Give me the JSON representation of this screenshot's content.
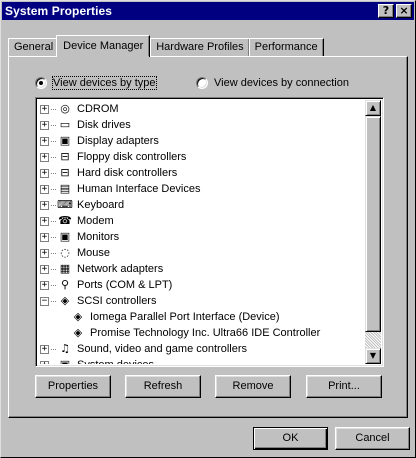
{
  "window": {
    "title": "System Properties",
    "help_label": "?",
    "close_label": "×"
  },
  "tabs": [
    {
      "label": "General"
    },
    {
      "label": "Device Manager"
    },
    {
      "label": "Hardware Profiles"
    },
    {
      "label": "Performance"
    }
  ],
  "active_tab": "Device Manager",
  "view_options": {
    "by_type": "View devices by type",
    "by_connection": "View devices by connection",
    "selected": "by_type"
  },
  "devices": [
    {
      "label": "CDROM",
      "icon": "cdrom-icon",
      "glyph": "◎",
      "expander": "+"
    },
    {
      "label": "Disk drives",
      "icon": "disk-drive-icon",
      "glyph": "▭",
      "expander": "+"
    },
    {
      "label": "Display adapters",
      "icon": "monitor-icon",
      "glyph": "▣",
      "expander": "+"
    },
    {
      "label": "Floppy disk controllers",
      "icon": "floppy-controller-icon",
      "glyph": "⊟",
      "expander": "+"
    },
    {
      "label": "Hard disk controllers",
      "icon": "hard-disk-controller-icon",
      "glyph": "⊟",
      "expander": "+"
    },
    {
      "label": "Human Interface Devices",
      "icon": "hid-icon",
      "glyph": "▤",
      "expander": "+"
    },
    {
      "label": "Keyboard",
      "icon": "keyboard-icon",
      "glyph": "⌨",
      "expander": "+"
    },
    {
      "label": "Modem",
      "icon": "modem-icon",
      "glyph": "☎",
      "expander": "+"
    },
    {
      "label": "Monitors",
      "icon": "monitor-icon",
      "glyph": "▣",
      "expander": "+"
    },
    {
      "label": "Mouse",
      "icon": "mouse-icon",
      "glyph": "◌",
      "expander": "+"
    },
    {
      "label": "Network adapters",
      "icon": "network-adapter-icon",
      "glyph": "▦",
      "expander": "+"
    },
    {
      "label": "Ports (COM & LPT)",
      "icon": "port-icon",
      "glyph": "⚲",
      "expander": "+"
    },
    {
      "label": "SCSI controllers",
      "icon": "scsi-icon",
      "glyph": "◈",
      "expander": "−",
      "children": [
        {
          "label": "Iomega Parallel Port Interface (Device)",
          "icon": "scsi-device-icon",
          "glyph": "◈"
        },
        {
          "label": "Promise Technology Inc. Ultra66 IDE Controller",
          "icon": "scsi-device-icon",
          "glyph": "◈"
        }
      ]
    },
    {
      "label": "Sound, video and game controllers",
      "icon": "sound-icon",
      "glyph": "♫",
      "expander": "+"
    },
    {
      "label": "System devices",
      "icon": "system-device-icon",
      "glyph": "▣",
      "expander": "+"
    }
  ],
  "buttons": {
    "properties": "Properties",
    "refresh": "Refresh",
    "remove": "Remove",
    "print": "Print...",
    "ok": "OK",
    "cancel": "Cancel"
  },
  "colors": {
    "titlebar": "#000080",
    "face": "#c0c0c0"
  }
}
